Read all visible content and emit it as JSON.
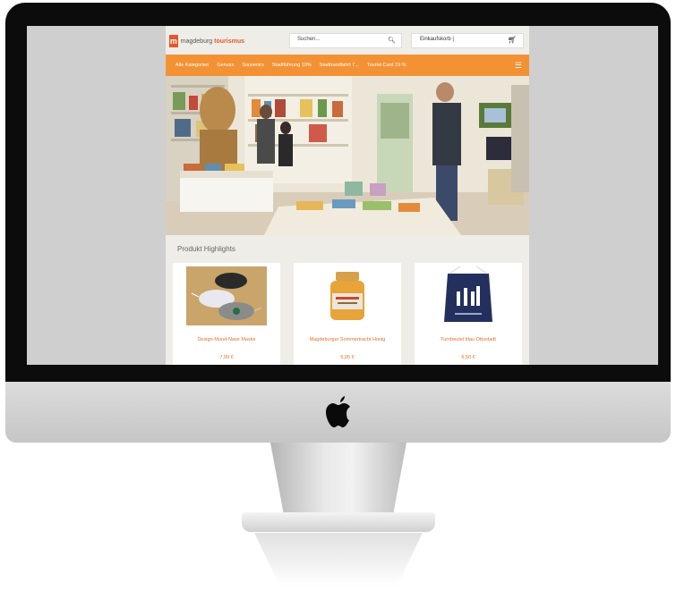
{
  "site": {
    "logo": {
      "mark": "m",
      "text_prefix": "magdeburg",
      "text_brand": "tourismus"
    },
    "search": {
      "placeholder": "Suchen..."
    },
    "cart": {
      "label": "Einkaufskorb |"
    },
    "nav": {
      "items": [
        {
          "label": "Alle Kategorien"
        },
        {
          "label": "Genuss"
        },
        {
          "label": "Souvenirs"
        },
        {
          "label": "Stadtführung 10%"
        },
        {
          "label": "Stadtrundfahrt 7..."
        },
        {
          "label": "Tourist Card 19 %"
        }
      ]
    },
    "highlights": {
      "title": "Produkt Highlights",
      "products": [
        {
          "name": "Design-Mund-Nase Maske",
          "price": "7,99 €"
        },
        {
          "name": "Magdeburger Sommertracht Honig",
          "price": "5,95 €"
        },
        {
          "name": "Turnbeutel blau Ottostadt",
          "price": "6,50 €"
        }
      ]
    }
  },
  "colors": {
    "accent": "#f39234",
    "brand": "#e4572e",
    "price": "#e4712b"
  },
  "icons": [
    "apple-logo-icon",
    "search-icon",
    "cart-icon",
    "menu-icon"
  ]
}
